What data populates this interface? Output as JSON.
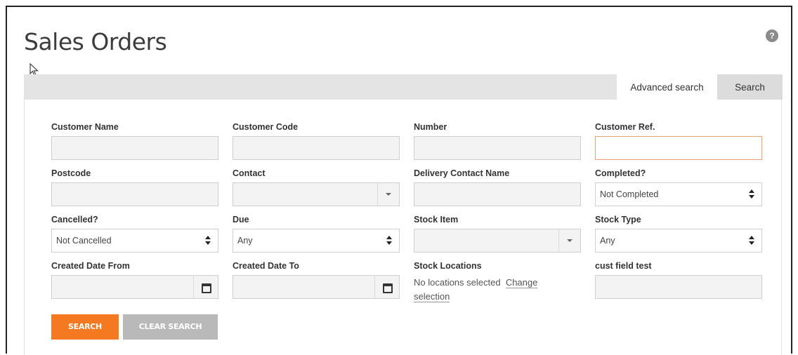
{
  "page": {
    "title": "Sales Orders",
    "help_icon": "?"
  },
  "tabs": [
    {
      "label": "Advanced search",
      "active": true
    },
    {
      "label": "Search",
      "active": false
    }
  ],
  "fields": {
    "customer_name": {
      "label": "Customer Name",
      "value": ""
    },
    "customer_code": {
      "label": "Customer Code",
      "value": ""
    },
    "number": {
      "label": "Number",
      "value": ""
    },
    "customer_ref": {
      "label": "Customer Ref.",
      "value": ""
    },
    "postcode": {
      "label": "Postcode",
      "value": ""
    },
    "contact": {
      "label": "Contact",
      "value": ""
    },
    "delivery_contact_name": {
      "label": "Delivery Contact Name",
      "value": ""
    },
    "completed": {
      "label": "Completed?",
      "value": "Not Completed"
    },
    "cancelled": {
      "label": "Cancelled?",
      "value": "Not Cancelled"
    },
    "due": {
      "label": "Due",
      "value": "Any"
    },
    "stock_item": {
      "label": "Stock Item",
      "value": ""
    },
    "stock_type": {
      "label": "Stock Type",
      "value": "Any"
    },
    "created_from": {
      "label": "Created Date From",
      "value": ""
    },
    "created_to": {
      "label": "Created Date To",
      "value": ""
    },
    "stock_locations": {
      "label": "Stock Locations",
      "value": "No locations selected",
      "change_link": "Change",
      "change_link_2": "selection"
    },
    "cust_field_test": {
      "label": "cust field test",
      "value": ""
    }
  },
  "buttons": {
    "search": "SEARCH",
    "clear": "CLEAR SEARCH"
  },
  "colors": {
    "accent": "#f47920",
    "focus_border": "#f0a070",
    "disabled_button": "#b9b9b9"
  }
}
